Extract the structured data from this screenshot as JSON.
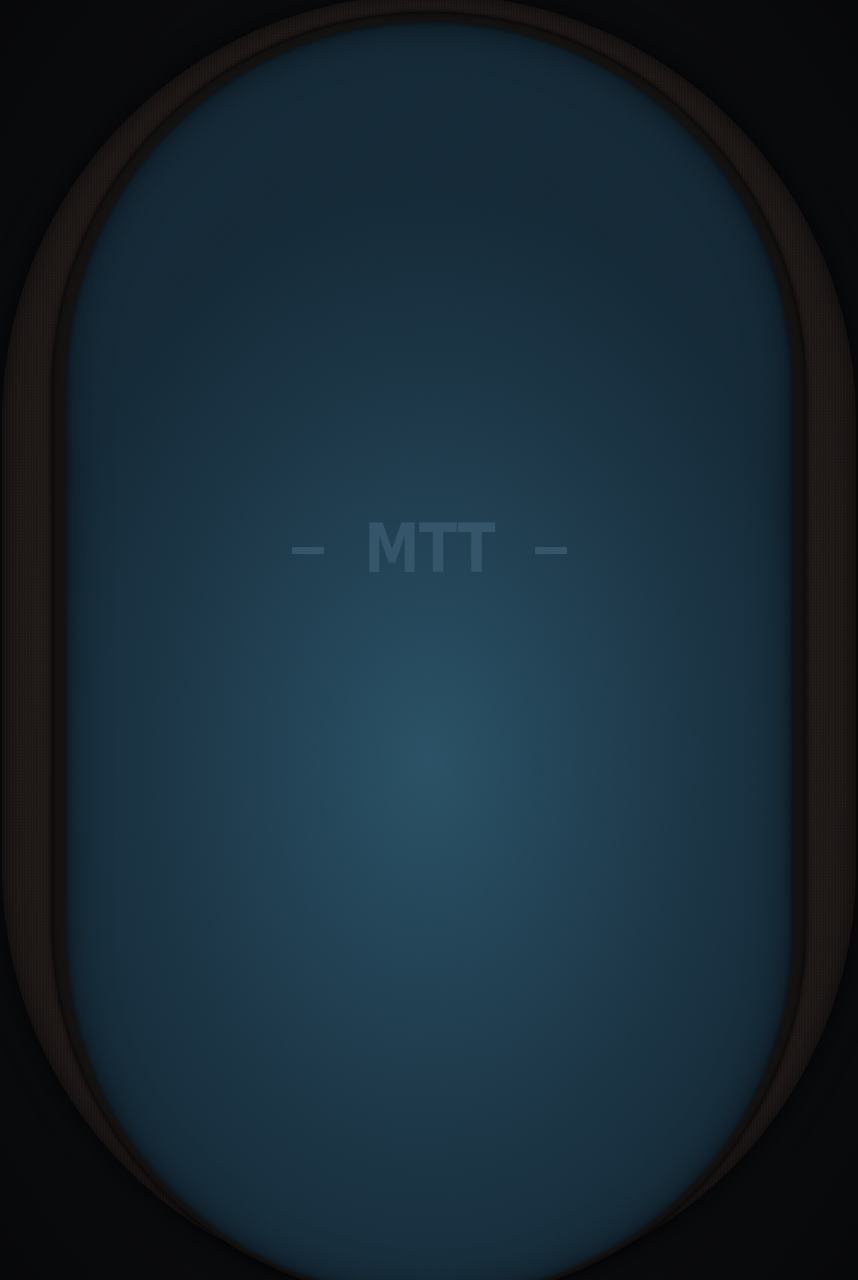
{
  "table": {
    "logo_text": "MTT",
    "felt_color": "#234457",
    "rail_color": "#211b19"
  }
}
